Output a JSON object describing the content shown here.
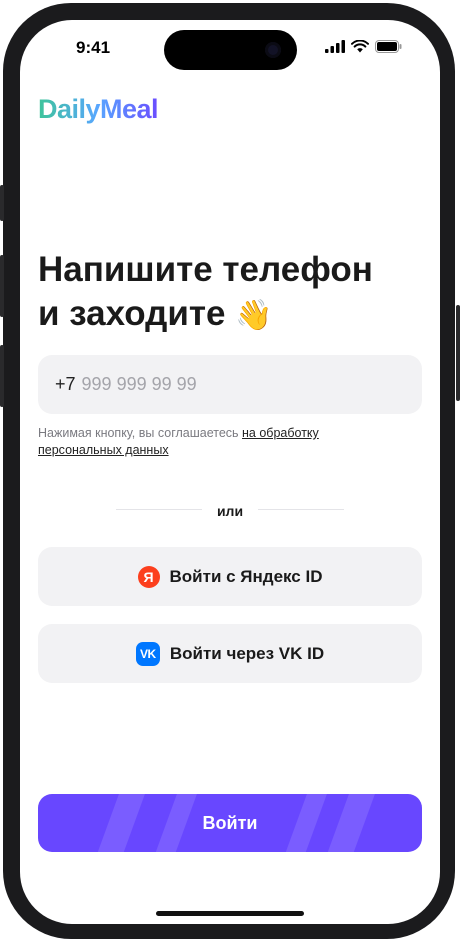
{
  "status_bar": {
    "time": "9:41"
  },
  "brand": {
    "logo_text": "DailyMeal"
  },
  "login": {
    "headline_line1": "Напишите телефон",
    "headline_line2": "и заходите",
    "headline_emoji": "👋",
    "phone_prefix": "+7",
    "phone_placeholder": "999 999 99 99",
    "consent_text": "Нажимая кнопку, вы соглашаетесь ",
    "consent_link": "на обработку персональных данных",
    "or_label": "или",
    "yandex_icon_glyph": "Я",
    "yandex_button": "Войти с Яндекс ID",
    "vk_icon_glyph": "VK",
    "vk_button": "Войти через VK ID",
    "submit_button": "Войти"
  },
  "colors": {
    "accent": "#6847ff",
    "yandex": "#fc3f1d",
    "vk": "#0077ff",
    "input_bg": "#f2f2f4"
  },
  "icons": [
    "signal-icon",
    "wifi-icon",
    "battery-icon",
    "yandex-icon",
    "vk-icon",
    "waving-hand-icon"
  ]
}
